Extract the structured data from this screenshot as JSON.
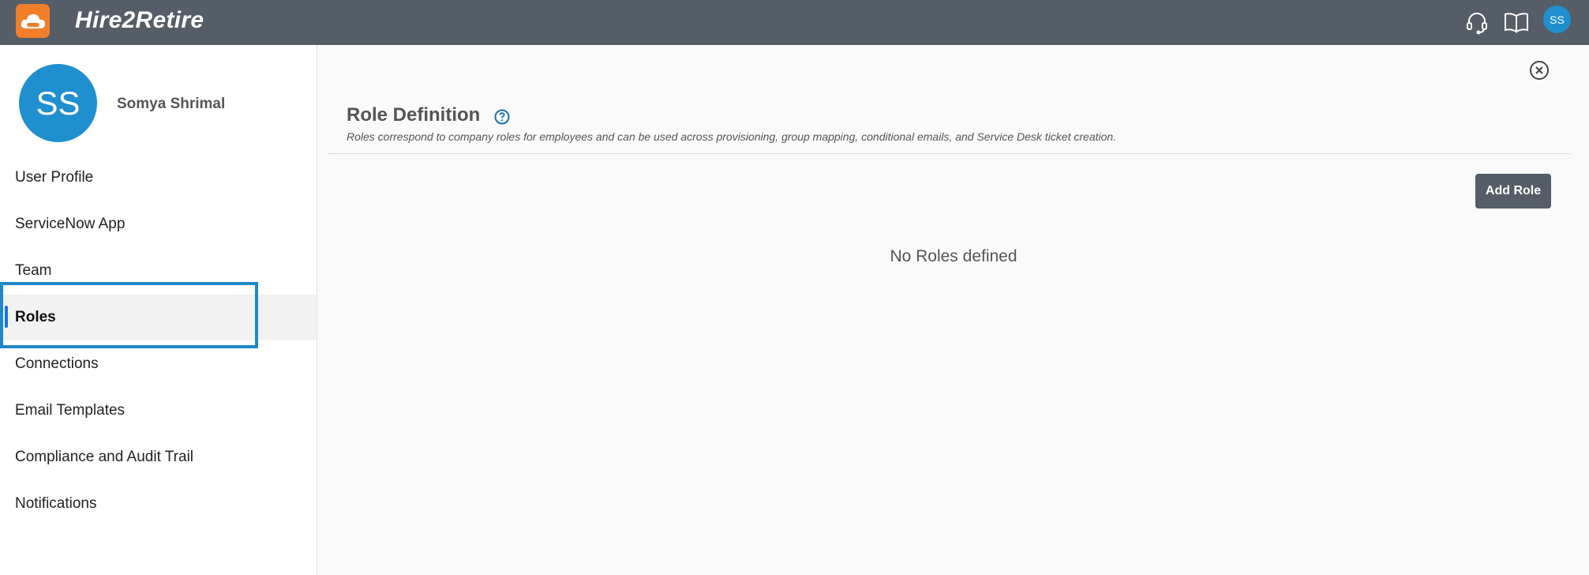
{
  "app": {
    "title": "Hire2Retire",
    "user_initials": "SS"
  },
  "topbar": {
    "icons": [
      "headset-icon",
      "book-icon"
    ]
  },
  "sidebar": {
    "profile": {
      "initials": "SS",
      "name": "Somya Shrimal"
    },
    "items": [
      {
        "label": "User Profile",
        "active": false
      },
      {
        "label": "ServiceNow App",
        "active": false
      },
      {
        "label": "Team",
        "active": false
      },
      {
        "label": "Roles",
        "active": true
      },
      {
        "label": "Connections",
        "active": false
      },
      {
        "label": "Email Templates",
        "active": false
      },
      {
        "label": "Compliance and Audit Trail",
        "active": false
      },
      {
        "label": "Notifications",
        "active": false
      }
    ]
  },
  "main": {
    "title": "Role Definition",
    "description": "Roles correspond to company roles for employees and can be used across provisioning, group mapping, conditional emails, and Service Desk ticket creation.",
    "add_button": "Add Role",
    "empty_message": "No Roles defined"
  },
  "colors": {
    "topbar": "#555e66",
    "logo": "#f07f2b",
    "avatar": "#1f8fcf",
    "highlight": "#1e88c8",
    "active_indicator": "#1a73e8"
  }
}
